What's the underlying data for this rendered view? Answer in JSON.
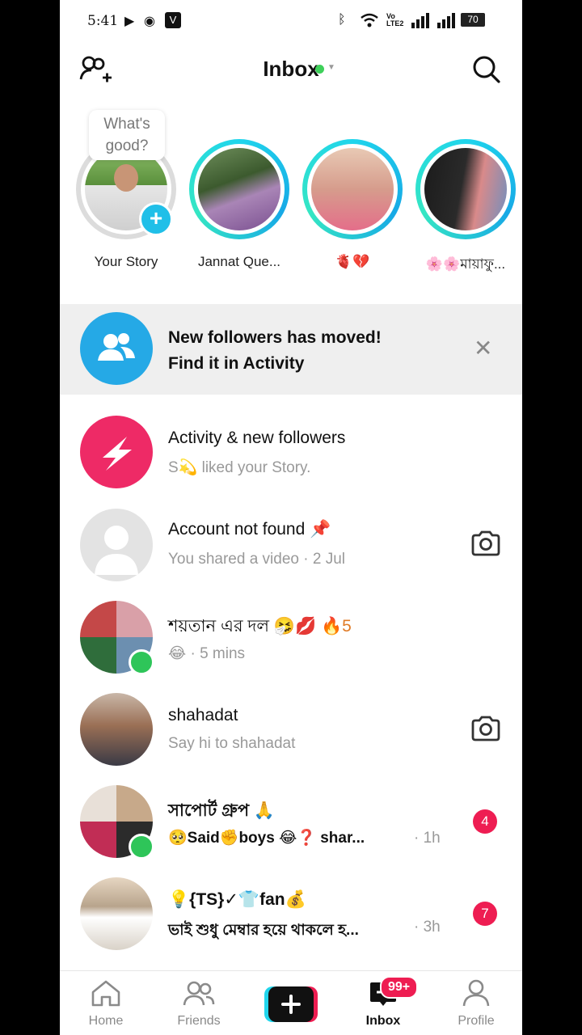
{
  "status_bar": {
    "time": "5:41",
    "network_label": "Vo\u0000LTE2",
    "battery": "70"
  },
  "header": {
    "title": "Inbox"
  },
  "stories": {
    "prompt": "What's good?",
    "items": [
      {
        "label": "Your Story"
      },
      {
        "label": "Jannat Que..."
      },
      {
        "label": "🫀💔"
      },
      {
        "label": "🌸🌸মায়াফু..."
      }
    ]
  },
  "banner": {
    "line1": "New followers has moved!",
    "line2": "Find it in Activity"
  },
  "conversations": [
    {
      "title": "Activity & new followers",
      "subtitle": "S💫 liked your Story."
    },
    {
      "title": "Account not found 📌",
      "subtitle": "You shared a video · 2 Jul"
    },
    {
      "title": "শয়তান এর দল 🤧💋 ",
      "streak": "🔥5",
      "subtitle": "😂 · 5 mins"
    },
    {
      "title": "shahadat",
      "subtitle": "Say hi to shahadat"
    },
    {
      "title": "সাপোর্ট গ্রুপ 🙏",
      "subtitle": "🥺Said✊boys 😂❓ shar...",
      "time": "· 1h",
      "unread": "4"
    },
    {
      "title": "💡{TS}✓👕fan💰",
      "subtitle": "ভাই শুধু মেম্বার হয়ে থাকলে হ...",
      "time": "· 3h",
      "unread": "7"
    }
  ],
  "nav": {
    "home": "Home",
    "friends": "Friends",
    "inbox": "Inbox",
    "inbox_badge": "99+",
    "profile": "Profile"
  },
  "colors": {
    "accent_pink": "#ee1d52",
    "story_ring": "#20d5ec",
    "online": "#2ec559"
  }
}
